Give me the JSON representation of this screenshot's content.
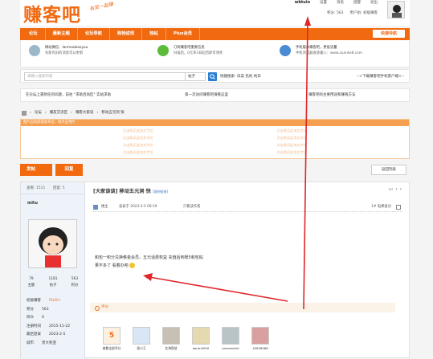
{
  "header": {
    "logo": "赚客吧",
    "logo_sub": "有奖一起赚",
    "links": [
      "wbtuio",
      "设置",
      "消息",
      "提醒",
      "退出"
    ],
    "credit": "积分: 563",
    "user_group": "用户组: 初级赚客"
  },
  "nav": {
    "items": [
      "论坛",
      "最新主题",
      "论坛导航",
      "购物返现",
      "热帖",
      "Plus会员"
    ],
    "quick": "快捷导航"
  },
  "info": {
    "col1": [
      "网站微信：lanmaobaoyou",
      "有新有旧的消息可以更新"
    ],
    "col2": [
      "订阅赚客吧重要信息",
      "扫描后，0元率3日起后即可领奖"
    ],
    "col3": [
      "手机版本赚客吧，更省流量",
      "手机浏览器直接输入：www.zuanke8.com"
    ]
  },
  "search": {
    "placeholder": "请输入搜索内容",
    "scope": "帖子",
    "hot": "快捷搜索: 白菜 先机 纯白",
    "download": "-->下载赚客吧手机客户端<--"
  },
  "notice": {
    "left": "在论坛上遇到任何问题，前往 \"求助咨询区\" 实站求助",
    "mid": "第一次访问赚客吧请看这里",
    "right": "赚客吧的主要用途和赚钱方法"
  },
  "breadcrumb": [
    "论坛",
    "赚友交流区",
    "赚客大家谈",
    "移动五元洞 快"
  ],
  "ad": {
    "bar": "图片自动获取发布位：请点击预约",
    "slot": "点击购买此块文字位"
  },
  "actions": {
    "post": "发帖",
    "reply": "回复",
    "back": "返回列表"
  },
  "post": {
    "views_label": "查看: 1511",
    "replies_label": "回复: 5",
    "username": "mitu",
    "title": "[大家谈谈] 移动五元洞 快",
    "copy_link": "[复制链接]",
    "floor": "楼主",
    "posted": "发表于 2023-2-5 09:19",
    "author_only": "只看该作者",
    "jump": "1# 电梯直达",
    "body_line1": "和包一积分兑换移金会员，五元话费权益 充值后到账5和包帖",
    "body_line2": "果不多了 看着办吧"
  },
  "user_stats": [
    {
      "num": "79",
      "label": "主题"
    },
    {
      "num": "1181",
      "label": "帖子"
    },
    {
      "num": "563",
      "label": "积分"
    }
  ],
  "user_rows": {
    "level": "初级赚客",
    "plus": "PLUS+",
    "credit_label": "积分",
    "credit": "563",
    "ask_label": "听众",
    "ask": "0",
    "reg_label": "注册时间",
    "reg": "2015-11-22",
    "last_label": "最后登录",
    "last": "2023-2-5",
    "city_label": "城市",
    "city": "贵大利亚"
  },
  "rating": {
    "label": "评分"
  },
  "raters": [
    "查看全部评分",
    "梁小王",
    "北海智慧",
    "aaron0000",
    "samandriel",
    "43628086"
  ],
  "rate_count": "5"
}
